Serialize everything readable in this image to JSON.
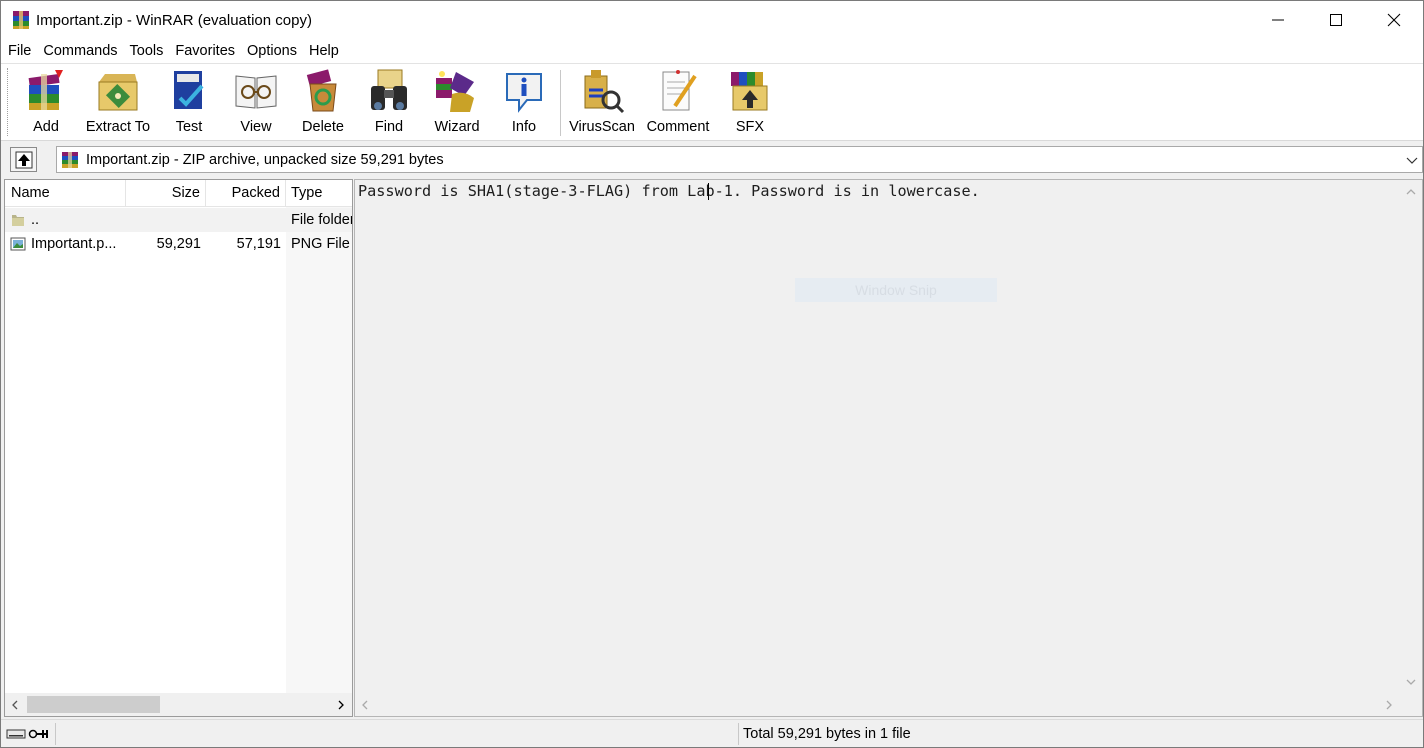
{
  "window": {
    "title": "Important.zip - WinRAR (evaluation copy)"
  },
  "menu": [
    "File",
    "Commands",
    "Tools",
    "Favorites",
    "Options",
    "Help"
  ],
  "toolbar": {
    "add": "Add",
    "extract_to": "Extract To",
    "test": "Test",
    "view": "View",
    "delete": "Delete",
    "find": "Find",
    "wizard": "Wizard",
    "info": "Info",
    "virusscan": "VirusScan",
    "comment": "Comment",
    "sfx": "SFX"
  },
  "address": {
    "path": "Important.zip - ZIP archive, unpacked size 59,291 bytes"
  },
  "filelist": {
    "columns": {
      "name": "Name",
      "size": "Size",
      "packed": "Packed",
      "type": "Type"
    },
    "rows": [
      {
        "name": "..",
        "size": "",
        "packed": "",
        "type": "File folder"
      },
      {
        "name": "Important.p...",
        "size": "59,291",
        "packed": "57,191",
        "type": "PNG File"
      }
    ]
  },
  "preview": {
    "text": "Password is SHA1(stage-3-FLAG) from Lab-1. Password is in lowercase.",
    "overlay": "Window Snip"
  },
  "status": {
    "total": "Total 59,291 bytes in 1 file"
  },
  "colors": {
    "preview_bg": "#f0f0f0",
    "accent_blue": "#1f4fbf"
  }
}
